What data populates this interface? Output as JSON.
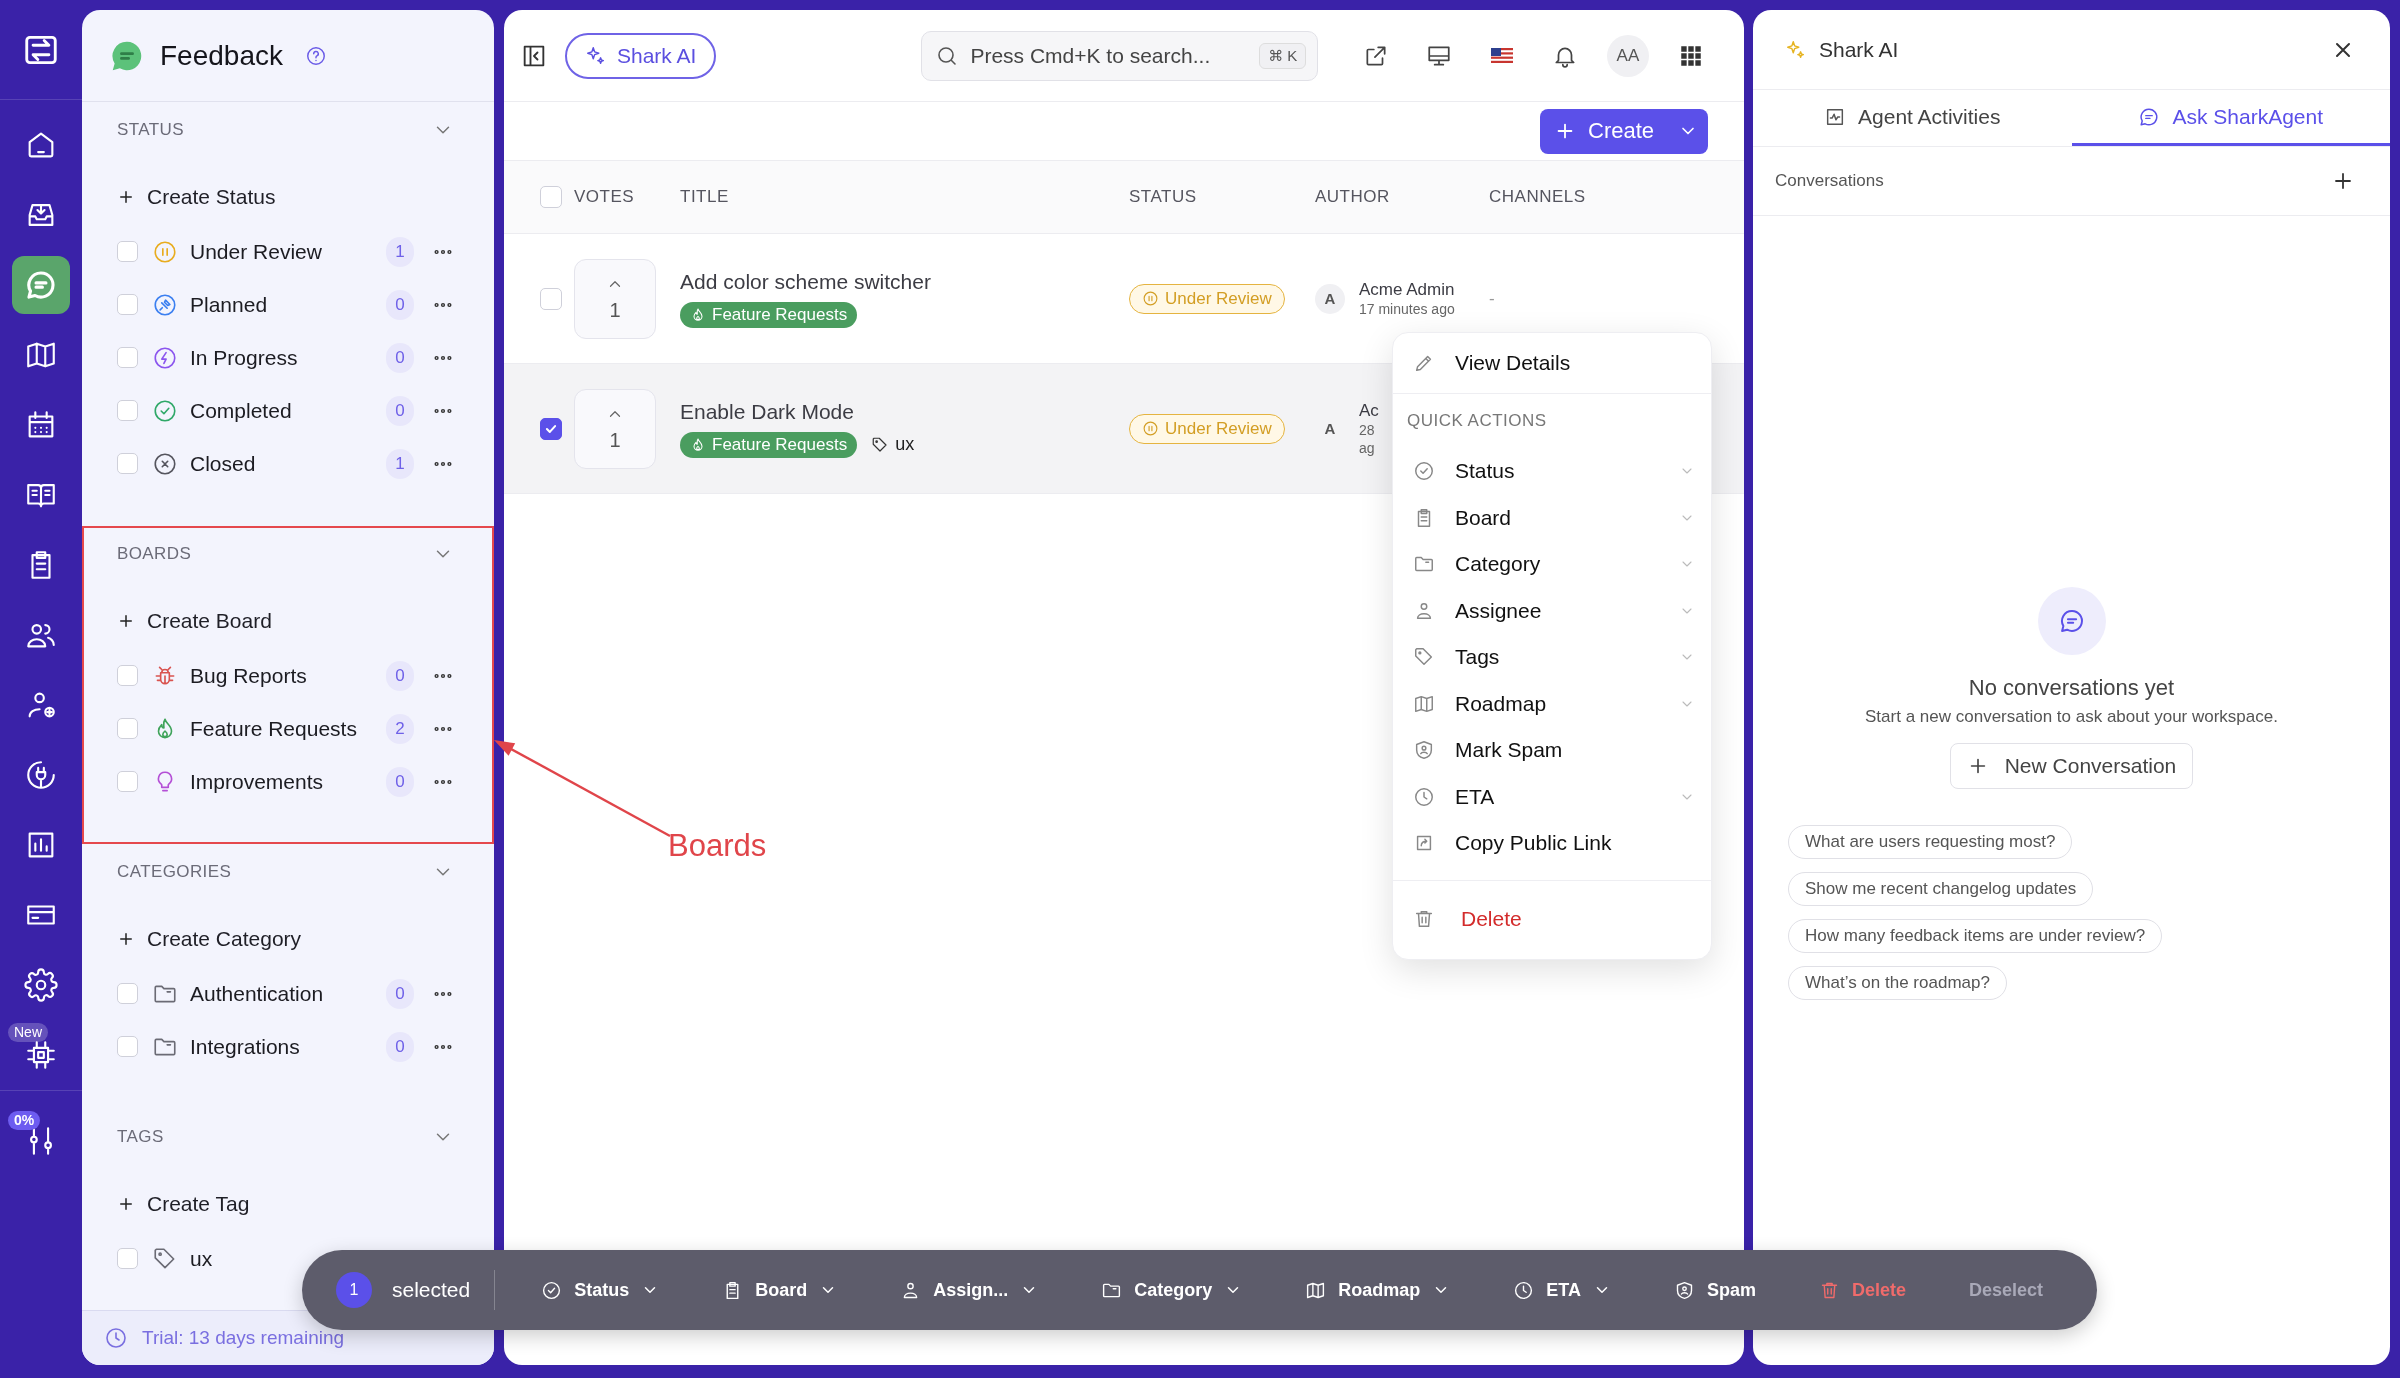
{
  "rail": {
    "items": [
      {
        "selected": false
      },
      {
        "selected": false
      },
      {
        "selected": true
      },
      {
        "selected": false
      },
      {
        "selected": false
      },
      {
        "selected": false
      },
      {
        "selected": false
      },
      {
        "selected": false
      },
      {
        "selected": false
      },
      {
        "selected": false
      },
      {
        "selected": false
      },
      {
        "selected": false
      },
      {
        "selected": false
      },
      {
        "selected": false,
        "badge": "New"
      },
      {
        "selected": false,
        "badge": "0%"
      }
    ]
  },
  "sidebar": {
    "title": "Feedback",
    "sections": [
      {
        "kind": "status",
        "title": "STATUS",
        "expanded": true,
        "highlighted": false,
        "create": "Create Status",
        "items": [
          {
            "label": "Under Review",
            "count": "1",
            "checked": false,
            "color": "#e8ac1e"
          },
          {
            "label": "Planned",
            "count": "0",
            "checked": false,
            "color": "#3b7ff0"
          },
          {
            "label": "In Progress",
            "count": "0",
            "checked": false,
            "color": "#8b55ee"
          },
          {
            "label": "Completed",
            "count": "0",
            "checked": false,
            "color": "#2fa868"
          },
          {
            "label": "Closed",
            "count": "1",
            "checked": false,
            "color": "#55555e"
          }
        ]
      },
      {
        "kind": "boards",
        "title": "BOARDS",
        "expanded": true,
        "highlighted": true,
        "create": "Create Board",
        "items": [
          {
            "label": "Bug Reports",
            "count": "0",
            "checked": false,
            "color": "#d9534f"
          },
          {
            "label": "Feature Requests",
            "count": "2",
            "checked": false,
            "color": "#3fa35a"
          },
          {
            "label": "Improvements",
            "count": "0",
            "checked": false,
            "color": "#b44fd6"
          }
        ]
      },
      {
        "kind": "categories",
        "title": "CATEGORIES",
        "expanded": true,
        "highlighted": false,
        "create": "Create Category",
        "items": [
          {
            "label": "Authentication",
            "count": "0",
            "checked": false
          },
          {
            "label": "Integrations",
            "count": "0",
            "checked": false
          }
        ]
      },
      {
        "kind": "tags",
        "title": "TAGS",
        "expanded": true,
        "highlighted": false,
        "create": "Create Tag",
        "items": [
          {
            "label": "ux",
            "checked": false
          }
        ]
      }
    ],
    "footer": "Trial: 13 days remaining"
  },
  "annotation": {
    "label": "Boards"
  },
  "topbar": {
    "ai_button": "Shark AI",
    "search_placeholder": "Press Cmd+K to search...",
    "shortcut": "⌘ K",
    "avatar": "AA"
  },
  "create_button": "Create",
  "table": {
    "all_checked": false,
    "columns": [
      "VOTES",
      "TITLE",
      "STATUS",
      "AUTHOR",
      "CHANNELS"
    ],
    "rows": [
      {
        "checked": false,
        "selected": false,
        "votes": "1",
        "title": "Add color scheme switcher",
        "board": "Feature Requests",
        "tags": [],
        "status": "Under Review",
        "author_initial": "A",
        "author": "Acme Admin",
        "time_lines": [
          "17 minutes ago"
        ],
        "channels": "-"
      },
      {
        "checked": true,
        "selected": true,
        "votes": "1",
        "title": "Enable Dark Mode",
        "board": "Feature Requests",
        "tags": [
          "ux"
        ],
        "status": "Under Review",
        "author_initial": "A",
        "author": "Ac",
        "time_lines": [
          "28",
          "ag"
        ]
      }
    ]
  },
  "context_menu": {
    "header": "View Details",
    "section": "QUICK ACTIONS",
    "items": [
      {
        "label": "Status",
        "has_submenu": true
      },
      {
        "label": "Board",
        "has_submenu": true
      },
      {
        "label": "Category",
        "has_submenu": true
      },
      {
        "label": "Assignee",
        "has_submenu": true
      },
      {
        "label": "Tags",
        "has_submenu": true
      },
      {
        "label": "Roadmap",
        "has_submenu": true
      },
      {
        "label": "Mark Spam",
        "has_submenu": false
      },
      {
        "label": "ETA",
        "has_submenu": true
      },
      {
        "label": "Copy Public Link",
        "has_submenu": false
      }
    ],
    "danger": "Delete"
  },
  "ai_panel": {
    "title": "Shark AI",
    "tabs": [
      {
        "label": "Agent Activities",
        "selected": false
      },
      {
        "label": "Ask SharkAgent",
        "selected": true
      }
    ],
    "section": "Conversations",
    "empty_title": "No conversations yet",
    "empty_text": "Start a new conversation to ask about your workspace.",
    "new_button": "New Conversation",
    "suggestions": [
      "What are users requesting most?",
      "Show me recent changelog updates",
      "How many feedback items are under review?",
      "What’s on the roadmap?"
    ]
  },
  "bulk_bar": {
    "count": "1",
    "label": "selected",
    "actions": [
      {
        "kind": "dropdown",
        "label": "Status"
      },
      {
        "kind": "dropdown",
        "label": "Board"
      },
      {
        "kind": "dropdown",
        "label": "Assign..."
      },
      {
        "kind": "dropdown",
        "label": "Category"
      },
      {
        "kind": "dropdown",
        "label": "Roadmap"
      },
      {
        "kind": "dropdown",
        "label": "ETA"
      },
      {
        "kind": "plain",
        "label": "Spam"
      },
      {
        "kind": "danger",
        "label": "Delete"
      },
      {
        "kind": "muted",
        "label": "Deselect"
      }
    ]
  }
}
